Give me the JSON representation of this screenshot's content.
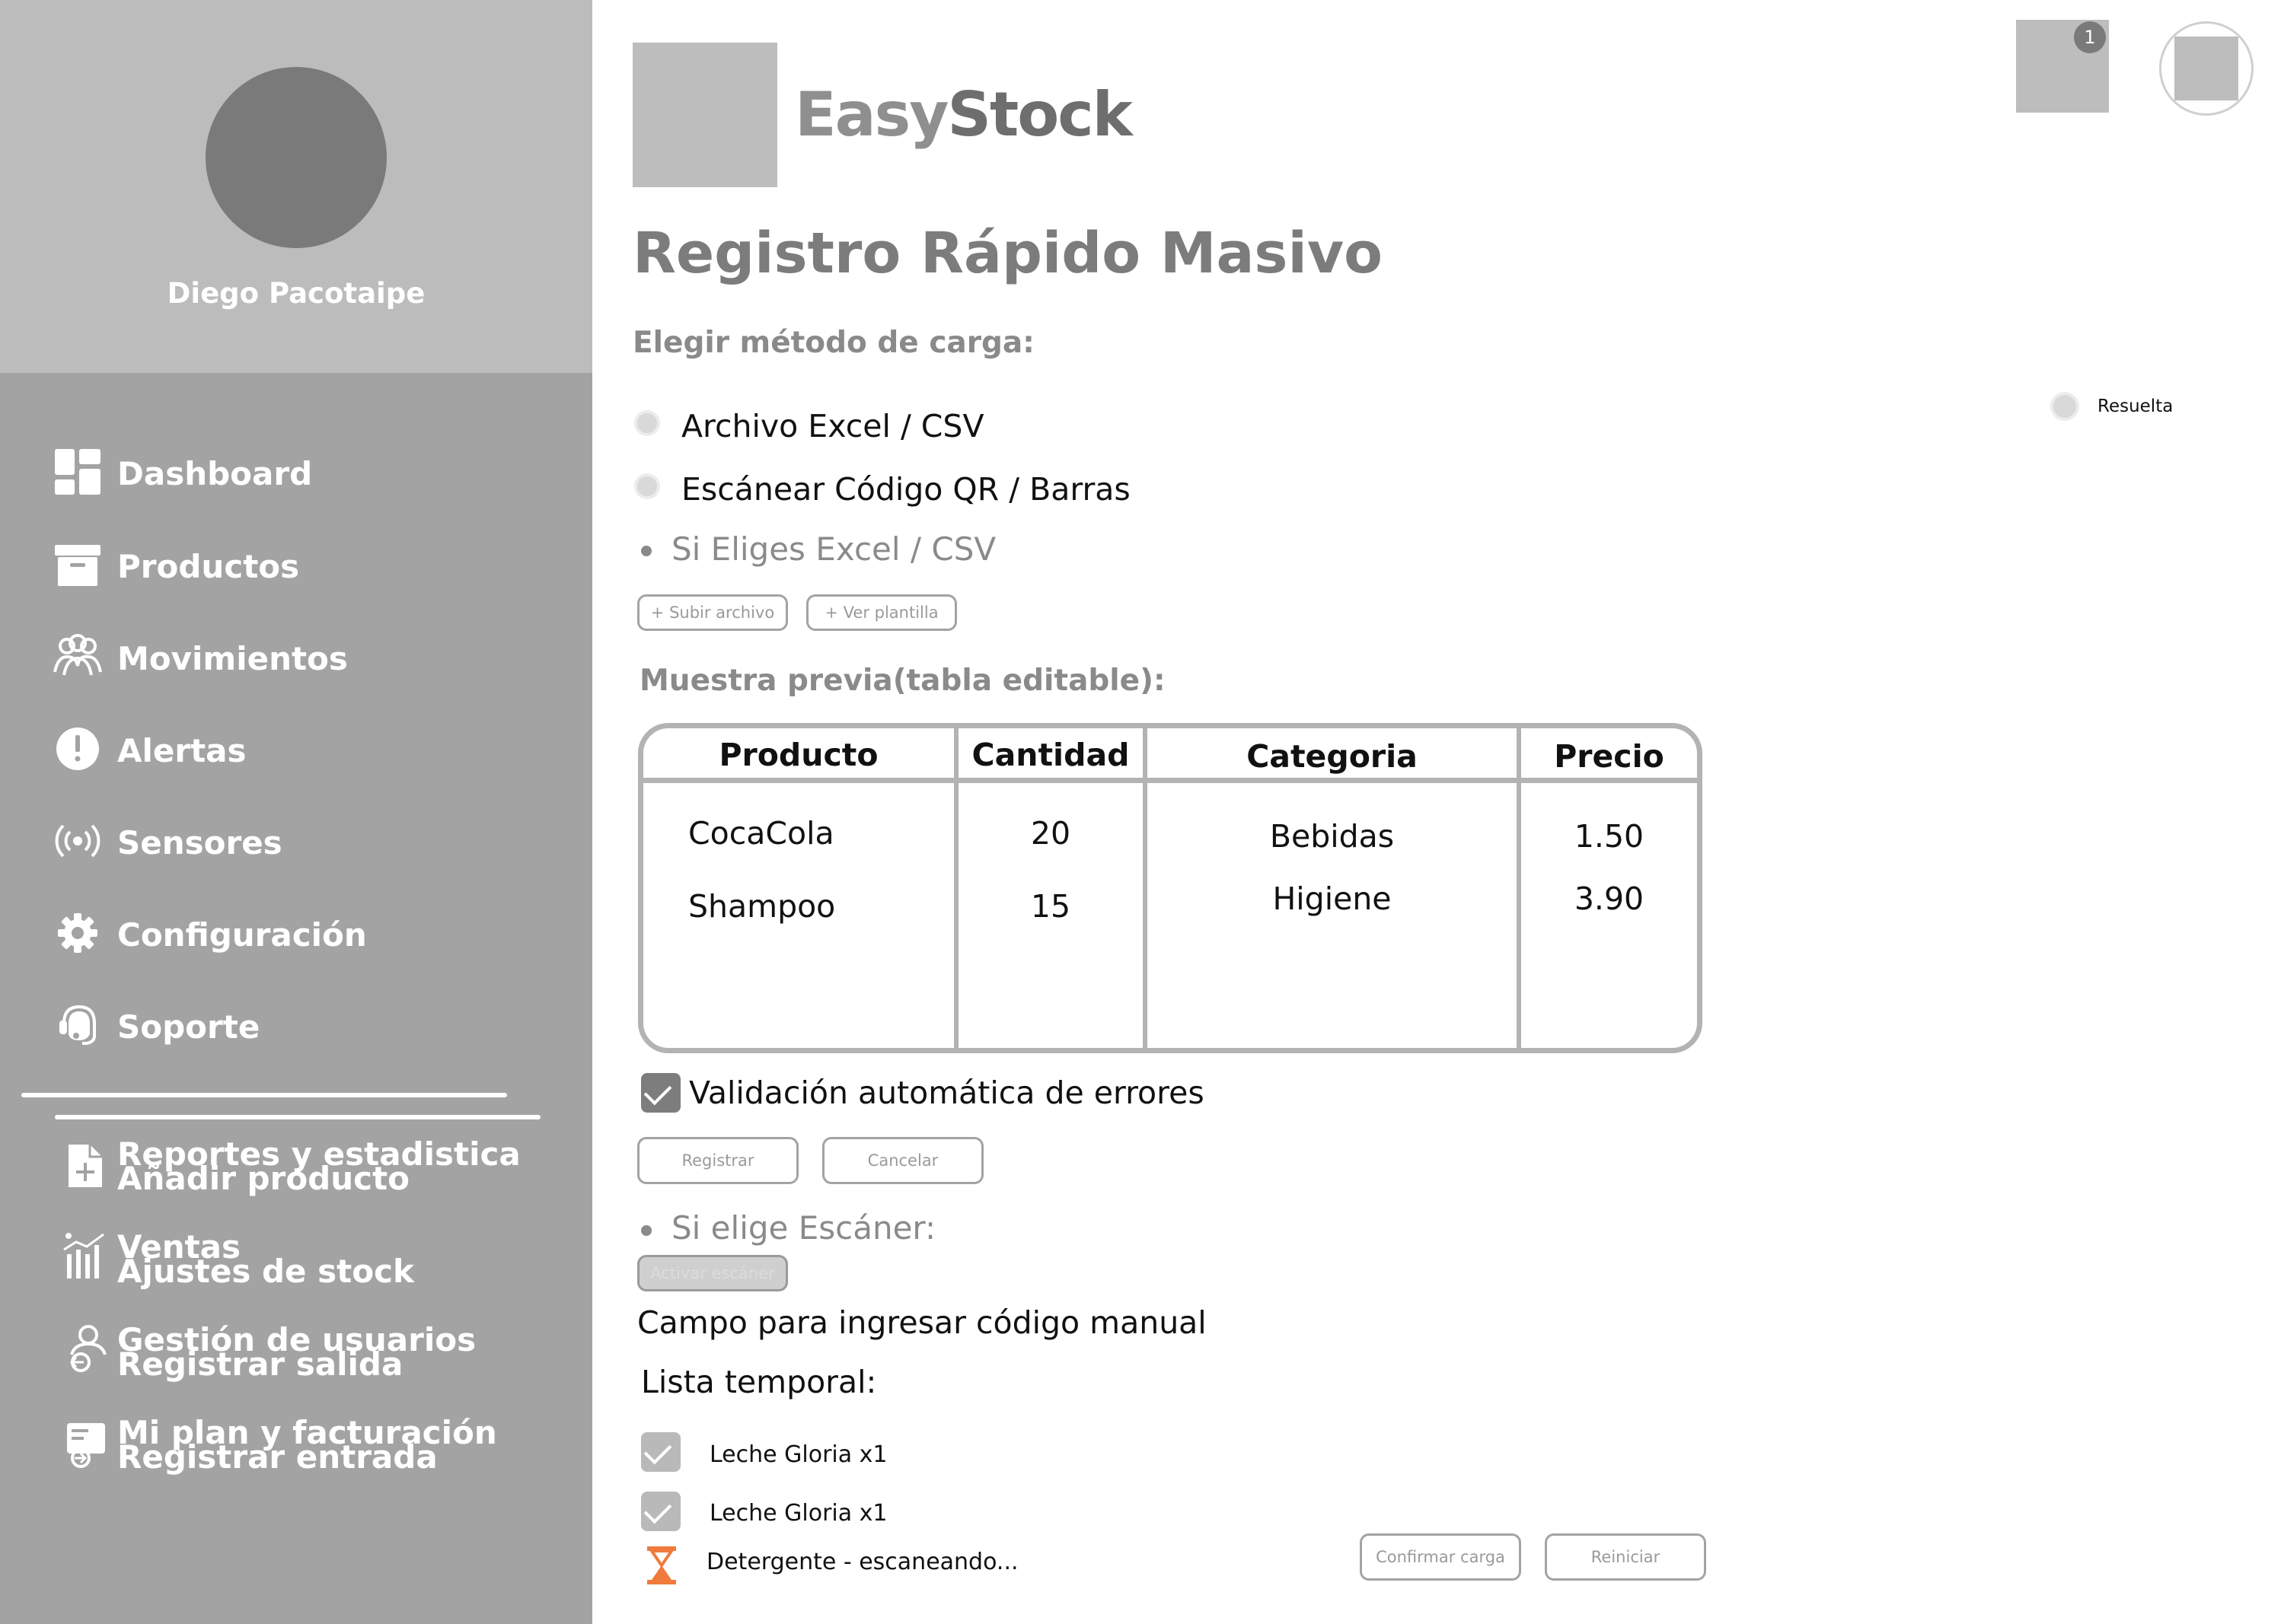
{
  "app": {
    "brand_part1": "Easy",
    "brand_part2": "Stock",
    "notification_count": "1"
  },
  "profile": {
    "name": "Diego Pacotaipe"
  },
  "sidebar": {
    "items": [
      {
        "label": "Dashboard",
        "icon": "dashboard-icon"
      },
      {
        "label": "Productos",
        "icon": "box-icon"
      },
      {
        "label": "Movimientos",
        "icon": "users-icon"
      },
      {
        "label": "Alertas",
        "icon": "alert-icon"
      },
      {
        "label": "Sensores",
        "icon": "sensor-icon"
      },
      {
        "label": "Configuración",
        "icon": "gear-icon"
      },
      {
        "label": "Soporte",
        "icon": "support-icon"
      }
    ],
    "overlap_items": [
      {
        "label_back": "Reportes y estadistica",
        "label_front": "Añadir producto",
        "icon": "add-file-icon"
      },
      {
        "label_back": "Ventas",
        "label_front": "Ajustes de stock",
        "icon": "chart-icon"
      },
      {
        "label_back": "Gestión de usuarios",
        "label_front": "Registrar salida",
        "icon": "user-exit-icon"
      },
      {
        "label_back": "Mi plan y facturación",
        "label_front": "Registrar entrada",
        "icon": "invoice-icon"
      }
    ]
  },
  "main": {
    "title": "Registro Rápido Masivo",
    "method_label": "Elegir método de carga:",
    "option_excel": "Archivo Excel / CSV",
    "option_scan": "Escánear Código QR / Barras",
    "excel_section": "Si Eliges Excel / CSV",
    "upload_button": "+ Subir archivo",
    "template_button": "+ Ver plantilla",
    "preview_label": "Muestra previa(tabla editable):",
    "table": {
      "headers": [
        "Producto",
        "Cantidad",
        "Categoria",
        "Precio"
      ],
      "rows": [
        [
          "CocaCola",
          "20",
          "Bebidas",
          "1.50"
        ],
        [
          "Shampoo",
          "15",
          "Higiene",
          "3.90"
        ]
      ]
    },
    "validation_label": "Validación automática de errores",
    "register_button": "Registrar",
    "cancel_button": "Cancelar",
    "scan_section": "Si elige Escáner:",
    "activate_scanner_button": "Activar escáner",
    "manual_code_label": "Campo para ingresar código manual",
    "temp_list_label": "Lista temporal:",
    "temp_items": [
      {
        "text": "Leche Gloria x1",
        "status": "done"
      },
      {
        "text": "Leche Gloria x1",
        "status": "done"
      },
      {
        "text": "Detergente - escaneando...",
        "status": "scanning"
      }
    ],
    "confirm_button": "Confirmar carga",
    "reset_button": "Reiniciar"
  },
  "floating": {
    "resuelta_label": "Resuelta"
  },
  "colors": {
    "sidebar_bg": "#a3a3a3",
    "profile_bg": "#bcbcbc",
    "hourglass": "#f07a3c"
  }
}
